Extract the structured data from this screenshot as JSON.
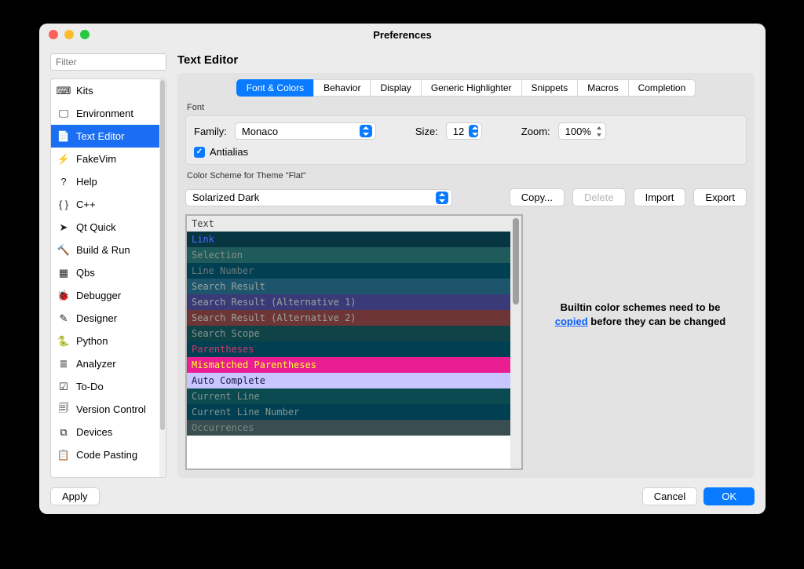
{
  "window": {
    "title": "Preferences"
  },
  "filter": {
    "placeholder": "Filter"
  },
  "sidebar": {
    "items": [
      {
        "label": "Kits",
        "icon": "kits-icon"
      },
      {
        "label": "Environment",
        "icon": "environment-icon"
      },
      {
        "label": "Text Editor",
        "icon": "text-editor-icon"
      },
      {
        "label": "FakeVim",
        "icon": "fakevim-icon"
      },
      {
        "label": "Help",
        "icon": "help-icon"
      },
      {
        "label": "C++",
        "icon": "cpp-icon"
      },
      {
        "label": "Qt Quick",
        "icon": "qtquick-icon"
      },
      {
        "label": "Build & Run",
        "icon": "build-run-icon"
      },
      {
        "label": "Qbs",
        "icon": "qbs-icon"
      },
      {
        "label": "Debugger",
        "icon": "debugger-icon"
      },
      {
        "label": "Designer",
        "icon": "designer-icon"
      },
      {
        "label": "Python",
        "icon": "python-icon"
      },
      {
        "label": "Analyzer",
        "icon": "analyzer-icon"
      },
      {
        "label": "To-Do",
        "icon": "todo-icon"
      },
      {
        "label": "Version Control",
        "icon": "version-control-icon"
      },
      {
        "label": "Devices",
        "icon": "devices-icon"
      },
      {
        "label": "Code Pasting",
        "icon": "code-pasting-icon"
      }
    ],
    "selected_index": 2
  },
  "page": {
    "title": "Text Editor"
  },
  "tabs": {
    "items": [
      "Font & Colors",
      "Behavior",
      "Display",
      "Generic Highlighter",
      "Snippets",
      "Macros",
      "Completion"
    ],
    "active_index": 0
  },
  "font": {
    "section_label": "Font",
    "family_label": "Family:",
    "family_value": "Monaco",
    "size_label": "Size:",
    "size_value": "12",
    "zoom_label": "Zoom:",
    "zoom_value": "100%",
    "antialias_label": "Antialias",
    "antialias_checked": true
  },
  "scheme": {
    "section_label": "Color Scheme for Theme \"Flat\"",
    "value": "Solarized Dark",
    "buttons": {
      "copy": "Copy...",
      "delete": "Delete",
      "import": "Import",
      "export": "Export"
    },
    "rows": [
      {
        "label": "Text",
        "bg": "#eaeaea",
        "fg": "#3b3e3e"
      },
      {
        "label": "Link",
        "bg": "#073642",
        "fg": "#4b6bff"
      },
      {
        "label": "Selection",
        "bg": "#1f5b5b",
        "fg": "#8a908c"
      },
      {
        "label": "Line Number",
        "bg": "#004052",
        "fg": "#6b7a78"
      },
      {
        "label": "Search Result",
        "bg": "#1d566c",
        "fg": "#9aa39e"
      },
      {
        "label": "Search Result (Alternative 1)",
        "bg": "#3a3a78",
        "fg": "#9aa39e"
      },
      {
        "label": "Search Result (Alternative 2)",
        "bg": "#6d3535",
        "fg": "#9aa39e"
      },
      {
        "label": "Search Scope",
        "bg": "#0f4347",
        "fg": "#879490"
      },
      {
        "label": "Parentheses",
        "bg": "#004052",
        "fg": "#d33b6a"
      },
      {
        "label": "Mismatched Parentheses",
        "bg": "#e91e92",
        "fg": "#ffff2a"
      },
      {
        "label": "Auto Complete",
        "bg": "#c9c6ff",
        "fg": "#151543"
      },
      {
        "label": "Current Line",
        "bg": "#0a4a50",
        "fg": "#879490"
      },
      {
        "label": "Current Line Number",
        "bg": "#004052",
        "fg": "#879490"
      },
      {
        "label": "Occurrences",
        "bg": "#3a4e52",
        "fg": "#7c8884"
      }
    ],
    "info_prefix": "Builtin color schemes need to be ",
    "info_link": "copied",
    "info_suffix": " before they can be changed"
  },
  "footer": {
    "apply": "Apply",
    "cancel": "Cancel",
    "ok": "OK"
  }
}
